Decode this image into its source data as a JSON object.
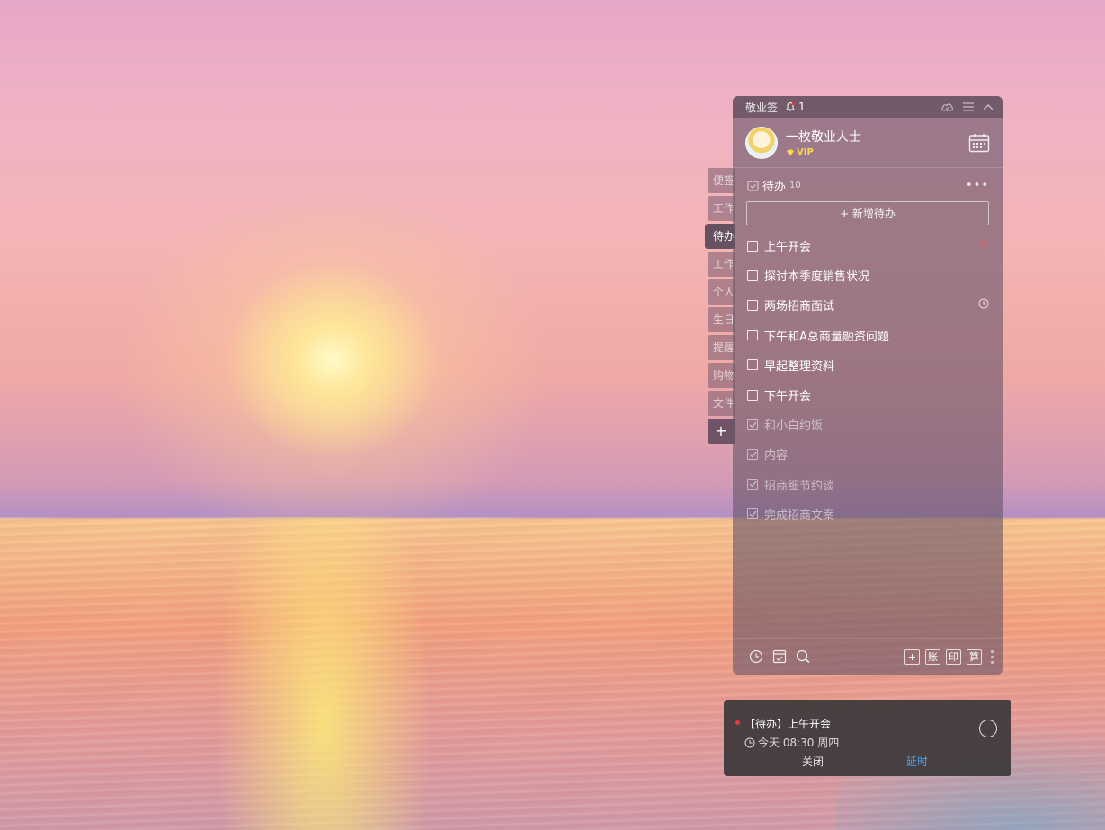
{
  "app": {
    "title": "敬业签",
    "notification_count": "1"
  },
  "user": {
    "name": "一枚敬业人士",
    "badge": "VIP"
  },
  "side_tabs": [
    "便签",
    "工作",
    "待办",
    "工作",
    "个人",
    "生日",
    "提醒",
    "购物",
    "文件"
  ],
  "side_tab_active_index": 2,
  "add_tab_label": "+",
  "section": {
    "title": "待办",
    "count": "10",
    "new_button": "+ 新增待办"
  },
  "todos": [
    {
      "text": "上午开会",
      "done": false,
      "icon": "heart-icon"
    },
    {
      "text": "探讨本季度销售状况",
      "done": false
    },
    {
      "text": "两场招商面试",
      "done": false,
      "icon": "clock-icon"
    },
    {
      "text": "下午和A总商量融资问题",
      "done": false
    },
    {
      "text": "早起整理资料",
      "done": false
    },
    {
      "text": "下午开会",
      "done": false
    },
    {
      "text": "和小白约饭",
      "done": true
    },
    {
      "text": "内容",
      "done": true
    },
    {
      "text": "招商细节约谈",
      "done": true
    },
    {
      "text": "完成招商文案",
      "done": true
    }
  ],
  "footer": {
    "buttons": [
      "+",
      "账",
      "印",
      "算"
    ]
  },
  "notification": {
    "title": "【待办】上午开会",
    "time": "今天 08:30 周四",
    "close_label": "关闭",
    "delay_label": "延时"
  },
  "colors": {
    "accent_blue": "#4aa3f0",
    "vip_gold": "#ffd54a",
    "alert_red": "#e53935"
  }
}
